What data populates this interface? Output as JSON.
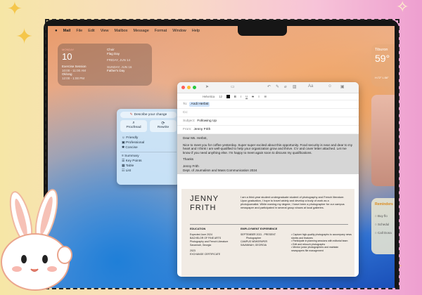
{
  "menubar": {
    "apple_icon": "apple-icon",
    "items": [
      "Mail",
      "File",
      "Edit",
      "View",
      "Mailbox",
      "Message",
      "Format",
      "Window",
      "Help"
    ]
  },
  "calendar_widget": {
    "day_label": "MONDAY",
    "day_number": "10",
    "events_left": [
      "Exercise Session",
      "10:00 - 11:00 AM",
      "Ok/ong",
      "12:00 - 1:00 PM"
    ],
    "events_right": [
      "Choir",
      "Flag Day",
      "FRIDAY, JUN 14",
      "SUNDAY, JUN 16",
      "Father's Day"
    ]
  },
  "weather_widget": {
    "city": "Tiburon",
    "temp": "59°",
    "hi_lo": "H:72° L:56°"
  },
  "reminders_widget": {
    "title": "Reminders",
    "items": [
      "Buy flo",
      "Schedul",
      "Call Dona"
    ]
  },
  "writing_tools": {
    "prompt": "Describe your change",
    "proofread": "Proofread",
    "rewrite": "Rewrite",
    "tones": [
      "Friendly",
      "Professional",
      "Concise"
    ],
    "formats": [
      "Summary",
      "Key Points",
      "Table",
      "List"
    ]
  },
  "mail": {
    "format_bar": [
      "Helvetica",
      "12",
      "B",
      "I",
      "U",
      "S"
    ],
    "to_label": "To:",
    "to_value": "Andi Herbst",
    "cc_label": "Cc:",
    "subject_label": "Subject:",
    "subject_value": "Following Up",
    "from_label": "From:",
    "from_value": "Jenny Frith",
    "greeting": "Dear Ms. Herbst,",
    "paragraph": "Nice to meet you for coffee yesterday. Super super excited about this opportunity. Food security is near and dear to my heart and I think I am well-qualified to help your organization grow and thrive. CV and cover letter attached. Let me know if you need anything else. I'm happy to meet again soon to discuss my qualifications.",
    "thanks": "Thanks",
    "sig_name": "Jenny Frith",
    "sig_dept": "Dept. of Journalism and Mass Communication 2024"
  },
  "resume": {
    "first_name": "JENNY",
    "last_name": "FRITH",
    "intro": "I am a third-year student undergraduate student of photography and French literature. Upon graduation, I hope to travel widely and develop a body of work as a photojournalist. While earning my degree, I have been a photographer for our campus newspaper and participated in several group shows at local galleries.",
    "edu_title": "EDUCATION",
    "edu_lines": [
      "Expected June 2024",
      "BACHELOR OF FINE ARTS",
      "Photography and French Literature",
      "Savannah, Georgia",
      "2023",
      "EXCHANGE CERTIFICATE"
    ],
    "emp_title": "EMPLOYMENT EXPERIENCE",
    "emp_lines": [
      "SEPTEMBER 2021 - PRESENT",
      "Photographer",
      "CAMPUS NEWSPAPER",
      "SAVANNAH, GEORGIA"
    ],
    "bullets": [
      "Capture high-quality photographs to accompany news stories and features",
      "Participate in planning sessions with editorial team",
      "Edit and retouch photographs",
      "Mentor junior photographers and maintain newspapers file management"
    ]
  },
  "colors": {
    "accent": "#2a7de1",
    "selection": "#d6d6d6",
    "chip": "#cfe3fb"
  }
}
